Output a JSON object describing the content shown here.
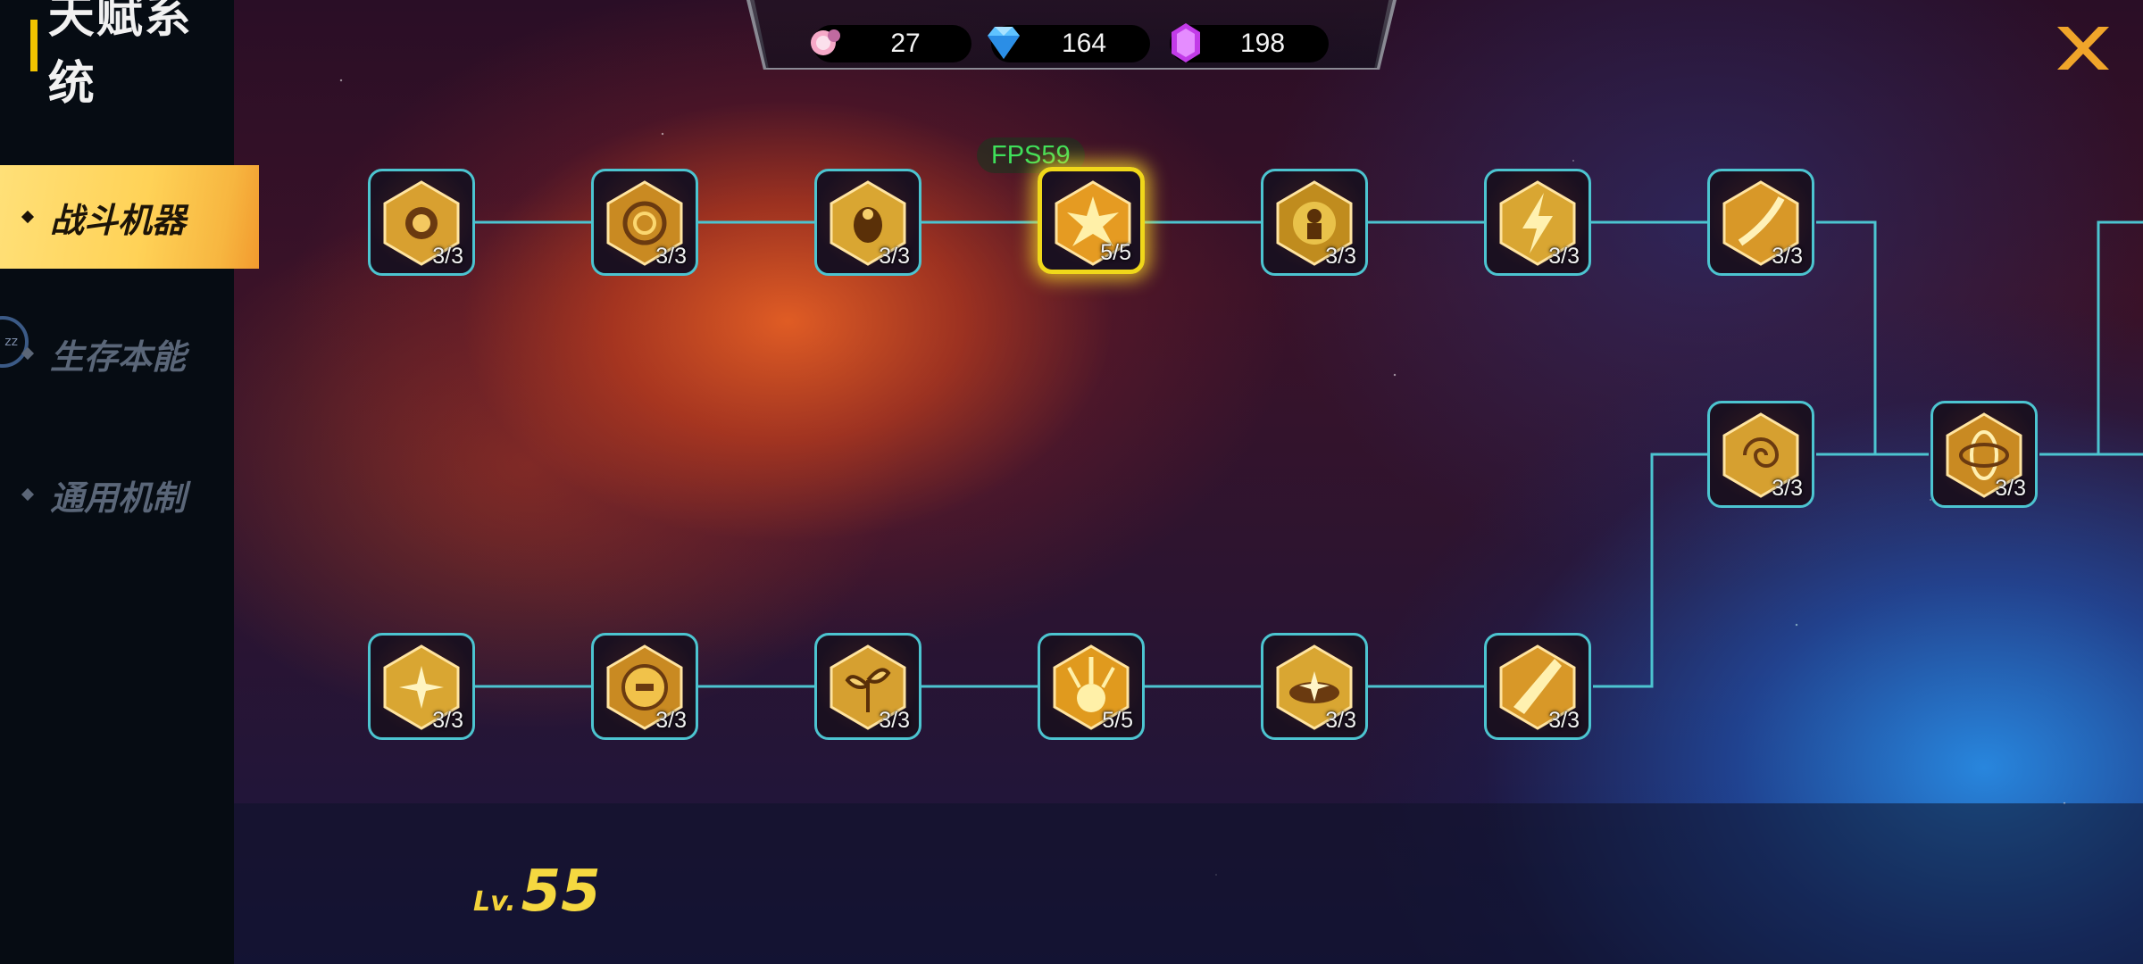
{
  "header": {
    "title": "天赋系统"
  },
  "sidebar": {
    "tabs": [
      {
        "label": "战斗机器",
        "active": true
      },
      {
        "label": "生存本能",
        "active": false
      },
      {
        "label": "通用机制",
        "active": false
      }
    ]
  },
  "currency": [
    {
      "icon": "candy-icon",
      "value": "27"
    },
    {
      "icon": "diamond-icon",
      "value": "164"
    },
    {
      "icon": "purple-crystal-icon",
      "value": "198"
    }
  ],
  "fps": "FPS59",
  "talent_nodes": {
    "row1": [
      "3/3",
      "3/3",
      "3/3",
      "5/5",
      "3/3",
      "3/3",
      "3/3"
    ],
    "row2": [
      "3/3",
      "3/3"
    ],
    "row3": [
      "3/3",
      "3/3",
      "3/3",
      "5/5",
      "3/3",
      "3/3"
    ]
  },
  "player": {
    "level_prefix": "Lv.",
    "level": "55"
  },
  "colors": {
    "accent": "#f2c400",
    "link": "#4cc4d0",
    "selected": "#f0d81a"
  }
}
